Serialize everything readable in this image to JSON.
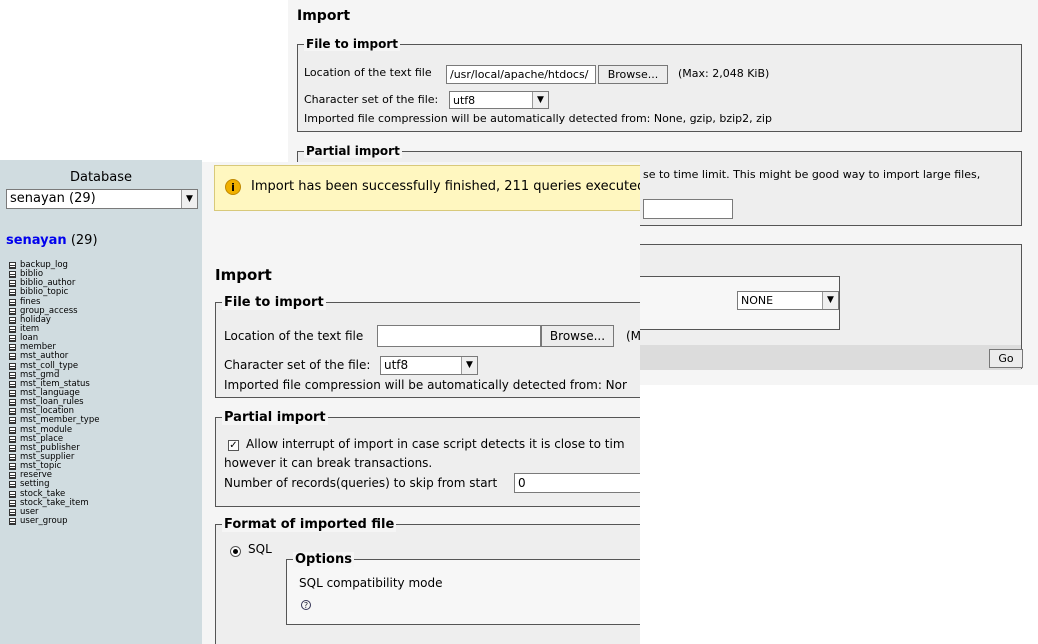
{
  "back": {
    "title": "Import",
    "file_section": {
      "legend": "File to import",
      "location_label": "Location of the text file",
      "location_value": "/usr/local/apache/htdocs/",
      "browse_label": "Browse...",
      "max_text": "(Max: 2,048 KiB)",
      "charset_label": "Character set of the file:",
      "charset_value": "utf8",
      "compression_text": "Imported file compression will be automatically detected from: None, gzip, bzip2, zip"
    },
    "partial_section": {
      "legend": "Partial import",
      "visible_text": "se to time limit. This might be good way to import large files,"
    },
    "format_section": {
      "compat_value": "NONE",
      "go_label": "Go"
    }
  },
  "sidebar": {
    "heading": "Database",
    "db_select_value": "senayan (29)",
    "db_name": "senayan",
    "db_count": "(29)",
    "tables": [
      "backup_log",
      "biblio",
      "biblio_author",
      "biblio_topic",
      "fines",
      "group_access",
      "holiday",
      "item",
      "loan",
      "member",
      "mst_author",
      "mst_coll_type",
      "mst_gmd",
      "mst_item_status",
      "mst_language",
      "mst_loan_rules",
      "mst_location",
      "mst_member_type",
      "mst_module",
      "mst_place",
      "mst_publisher",
      "mst_supplier",
      "mst_topic",
      "reserve",
      "setting",
      "stock_take",
      "stock_take_item",
      "user",
      "user_group"
    ]
  },
  "front": {
    "notice": "Import has been successfully finished, 211 queries executed.",
    "title": "Import",
    "file_section": {
      "legend": "File to import",
      "location_label": "Location of the text file",
      "location_value": "",
      "browse_label": "Browse...",
      "max_text": "(M",
      "charset_label": "Character set of the file:",
      "charset_value": "utf8",
      "compression_text": "Imported file compression will be automatically detected from: Nor"
    },
    "partial_section": {
      "legend": "Partial import",
      "allow_interrupt_text": "Allow interrupt of import in case script detects it is close to tim",
      "allow_interrupt_checked": true,
      "continuation_text": "however it can break transactions.",
      "skip_label": "Number of records(queries) to skip from start",
      "skip_value": "0"
    },
    "format_section": {
      "legend": "Format of imported file",
      "format_option": "SQL",
      "options_legend": "Options",
      "compat_label": "SQL compatibility mode",
      "help_icon": "question-icon"
    }
  }
}
